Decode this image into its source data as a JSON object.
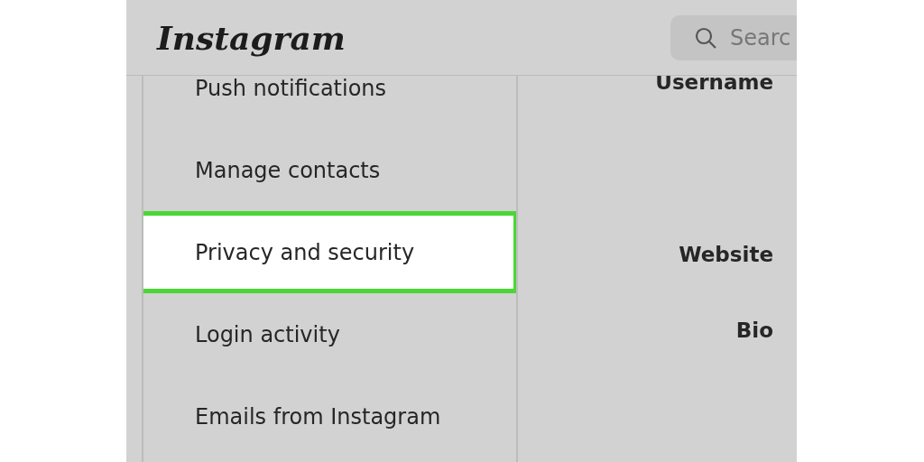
{
  "header": {
    "logo": "Instagram",
    "search": {
      "placeholder": "Searc"
    }
  },
  "sidebar": {
    "items": [
      {
        "label": "Push notifications",
        "selected": false
      },
      {
        "label": "Manage contacts",
        "selected": false
      },
      {
        "label": "Privacy and security",
        "selected": true
      },
      {
        "label": "Login activity",
        "selected": false
      },
      {
        "label": "Emails from Instagram",
        "selected": false
      }
    ]
  },
  "form": {
    "fields": [
      {
        "label": "Username"
      },
      {
        "label": "Website"
      },
      {
        "label": "Bio"
      }
    ]
  }
}
